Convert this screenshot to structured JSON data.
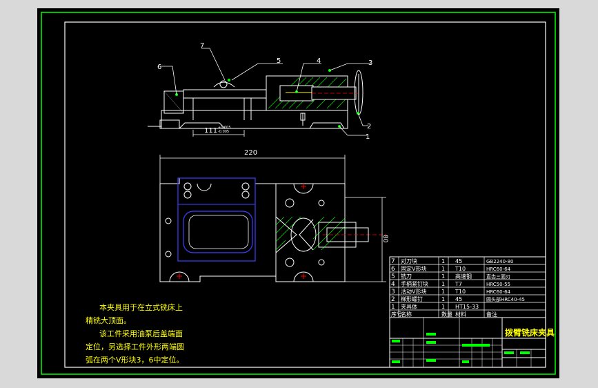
{
  "drawing": {
    "callouts": [
      "7",
      "6",
      "5",
      "4",
      "3",
      "2",
      "1"
    ],
    "dim_111": "111",
    "dim_tol_upper": "+0.005",
    "dim_tol_lower": "-0.005",
    "dim_220": "220",
    "dim_right": "80"
  },
  "notes": {
    "line1": "本夹具用于在立式铣床上",
    "line2": "精铣大顶面。",
    "line3": "该工件采用油泵后盖端面",
    "line4": "定位，另选择工件外形两端圆",
    "line5": "弧在两个V形块3，6中定位。"
  },
  "bom": {
    "rows": [
      {
        "no": "7",
        "name": "对刀块",
        "qty": "1",
        "material": "45",
        "remark": "GB2240-80"
      },
      {
        "no": "6",
        "name": "固定V形块",
        "qty": "1",
        "material": "T10",
        "remark": "HRC60-64"
      },
      {
        "no": "5",
        "name": "铣刀",
        "qty": "1",
        "material": "高速钢",
        "remark": "直齿三面刃"
      },
      {
        "no": "4",
        "name": "手柄紧钉块",
        "qty": "1",
        "material": "T7",
        "remark": "HRC50-55"
      },
      {
        "no": "3",
        "name": "活动V形块",
        "qty": "1",
        "material": "T10",
        "remark": "HRC60-64"
      },
      {
        "no": "2",
        "name": "梯形螺钉",
        "qty": "1",
        "material": "45",
        "remark": "圆头部HRC40-45"
      },
      {
        "no": "1",
        "name": "夹具体",
        "qty": "1",
        "material": "HT15-33",
        "remark": ""
      }
    ],
    "header": {
      "no": "序号",
      "name": "名称",
      "qty": "数量",
      "material": "材料",
      "remark": "备注"
    }
  },
  "title_block": {
    "title": "拨臂铣床夹具"
  }
}
